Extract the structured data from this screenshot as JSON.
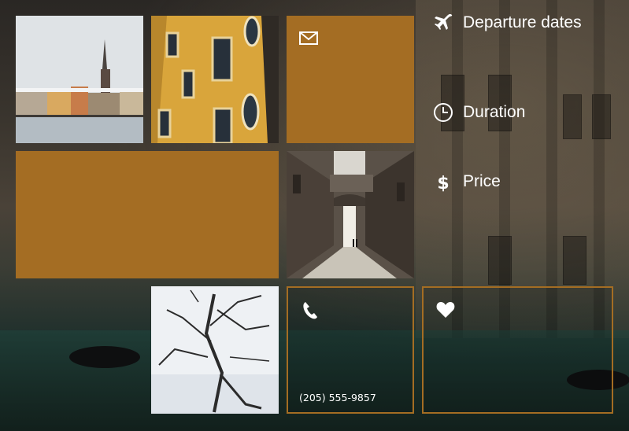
{
  "colors": {
    "accent": "#a46d23"
  },
  "photos": {
    "stockholm": "stockholm-skyline-photo",
    "yellow_building": "yellow-building-photo",
    "alley": "snowy-alley-photo",
    "tree": "snowy-tree-photo"
  },
  "tiles": {
    "mail": {
      "icon": "envelope-icon"
    },
    "phone": {
      "icon": "phone-icon",
      "number": "(205) 555-9857"
    },
    "favorite": {
      "icon": "heart-icon"
    }
  },
  "menu": [
    {
      "icon": "airplane-icon",
      "label": "Departure dates"
    },
    {
      "icon": "clock-icon",
      "label": "Duration"
    },
    {
      "icon": "dollar-icon",
      "label": "Price"
    }
  ]
}
